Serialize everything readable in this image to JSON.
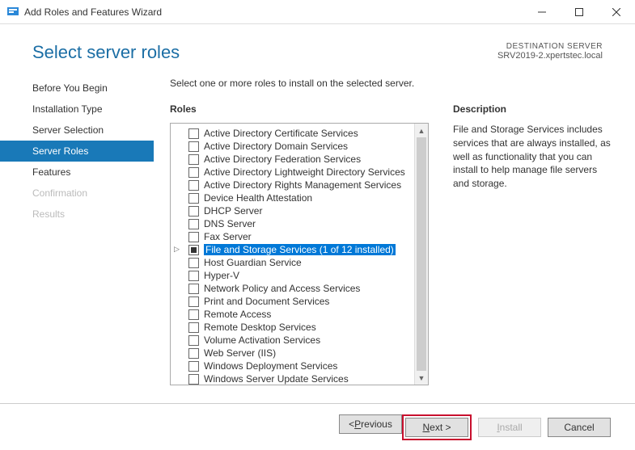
{
  "window": {
    "title": "Add Roles and Features Wizard"
  },
  "header": {
    "page_title": "Select server roles",
    "destination_label": "DESTINATION SERVER",
    "destination_server": "SRV2019-2.xpertstec.local"
  },
  "sidebar": {
    "items": [
      {
        "label": "Before You Begin",
        "state": "normal"
      },
      {
        "label": "Installation Type",
        "state": "normal"
      },
      {
        "label": "Server Selection",
        "state": "normal"
      },
      {
        "label": "Server Roles",
        "state": "active"
      },
      {
        "label": "Features",
        "state": "normal"
      },
      {
        "label": "Confirmation",
        "state": "disabled"
      },
      {
        "label": "Results",
        "state": "disabled"
      }
    ]
  },
  "main": {
    "instruction": "Select one or more roles to install on the selected server.",
    "roles_heading": "Roles",
    "description_heading": "Description",
    "description_text": "File and Storage Services includes services that are always installed, as well as functionality that you can install to help manage file servers and storage.",
    "roles": [
      {
        "label": "Active Directory Certificate Services",
        "checked": false
      },
      {
        "label": "Active Directory Domain Services",
        "checked": false
      },
      {
        "label": "Active Directory Federation Services",
        "checked": false
      },
      {
        "label": "Active Directory Lightweight Directory Services",
        "checked": false
      },
      {
        "label": "Active Directory Rights Management Services",
        "checked": false
      },
      {
        "label": "Device Health Attestation",
        "checked": false
      },
      {
        "label": "DHCP Server",
        "checked": false
      },
      {
        "label": "DNS Server",
        "checked": false
      },
      {
        "label": "Fax Server",
        "checked": false
      },
      {
        "label": "File and Storage Services (1 of 12 installed)",
        "checked": "indeterminate",
        "selected": true,
        "expandable": true
      },
      {
        "label": "Host Guardian Service",
        "checked": false
      },
      {
        "label": "Hyper-V",
        "checked": false
      },
      {
        "label": "Network Policy and Access Services",
        "checked": false
      },
      {
        "label": "Print and Document Services",
        "checked": false
      },
      {
        "label": "Remote Access",
        "checked": false
      },
      {
        "label": "Remote Desktop Services",
        "checked": false
      },
      {
        "label": "Volume Activation Services",
        "checked": false
      },
      {
        "label": "Web Server (IIS)",
        "checked": false
      },
      {
        "label": "Windows Deployment Services",
        "checked": false
      },
      {
        "label": "Windows Server Update Services",
        "checked": false
      }
    ]
  },
  "footer": {
    "previous": "< Previous",
    "next": "Next >",
    "install": "Install",
    "cancel": "Cancel"
  }
}
